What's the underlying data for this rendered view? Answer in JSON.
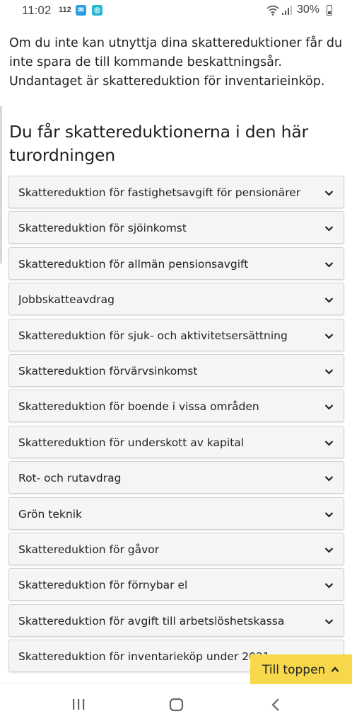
{
  "status_bar": {
    "time": "11:02",
    "badge": "112",
    "battery": "30%"
  },
  "intro_text": "Om du inte kan utnyttja dina skattereduktioner får du inte spara de till kommande beskattningsår. Undantaget är skattereduktion för inventarieinköp.",
  "section_title": "Du får skattereduktionerna i den här turordningen",
  "accordion_items": [
    "Skattereduktion för fastighetsavgift för pensionärer",
    "Skattereduktion för sjöinkomst",
    "Skattereduktion för allmän pensionsavgift",
    "Jobbskatteavdrag",
    "Skattereduktion för sjuk- och aktivitetsersättning",
    "Skattereduktion förvärvsinkomst",
    "Skattereduktion för boende i vissa områden",
    "Skattereduktion för underskott av kapital",
    "Rot- och rutavdrag",
    "Grön teknik",
    "Skattereduktion för gåvor",
    "Skattereduktion för förnybar el",
    "Skattereduktion för avgift till arbetslöshetskassa",
    "Skattereduktion för inventarieköp under 2021"
  ],
  "to_top_label": "Till toppen",
  "colors": {
    "accent_button": "#f8d84b",
    "item_background": "#f5f5f5"
  },
  "icons": {
    "accordion": "chevron-down-icon",
    "to_top": "chevron-up-icon",
    "nav": [
      "recent-apps-icon",
      "home-icon",
      "back-icon"
    ]
  }
}
